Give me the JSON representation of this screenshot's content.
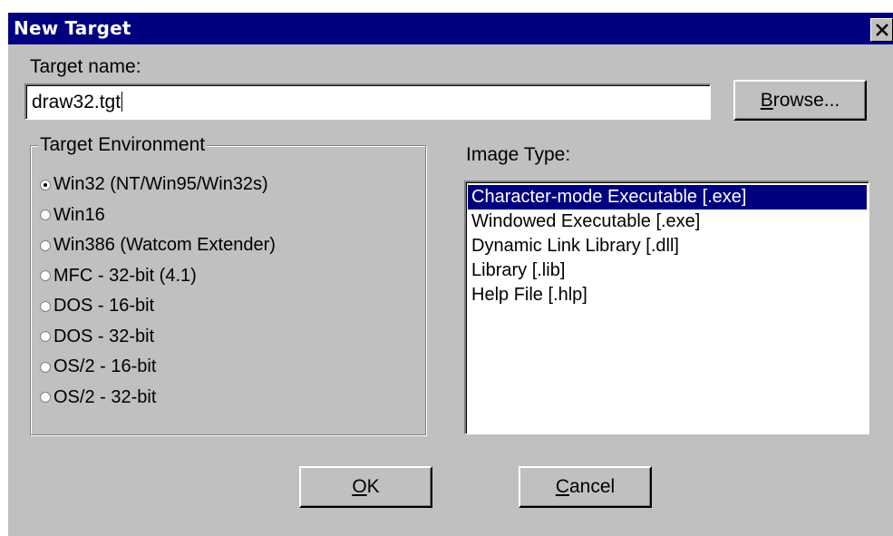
{
  "window": {
    "title": "New Target",
    "close_icon": "close-icon"
  },
  "target_name": {
    "label": "Target name:",
    "value": "draw32.tgt"
  },
  "browse_button": {
    "label_underlined": "B",
    "label_rest": "rowse..."
  },
  "target_environment": {
    "legend": "Target Environment",
    "selected_index": 0,
    "options": [
      "Win32 (NT/Win95/Win32s)",
      "Win16",
      "Win386 (Watcom Extender)",
      "MFC - 32-bit (4.1)",
      "DOS - 16-bit",
      "DOS - 32-bit",
      "OS/2 - 16-bit",
      "OS/2 - 32-bit"
    ]
  },
  "image_type": {
    "label": "Image Type:",
    "selected_index": 0,
    "items": [
      "Character-mode Executable [.exe]",
      "Windowed Executable [.exe]",
      "Dynamic Link Library [.dll]",
      "Library [.lib]",
      "Help File [.hlp]"
    ]
  },
  "ok_button": {
    "label_underlined": "O",
    "label_rest": "K"
  },
  "cancel_button": {
    "label_underlined": "C",
    "label_rest": "ancel"
  },
  "colors": {
    "titlebar": "#000080",
    "face": "#c0c0c0",
    "selection": "#000080"
  }
}
